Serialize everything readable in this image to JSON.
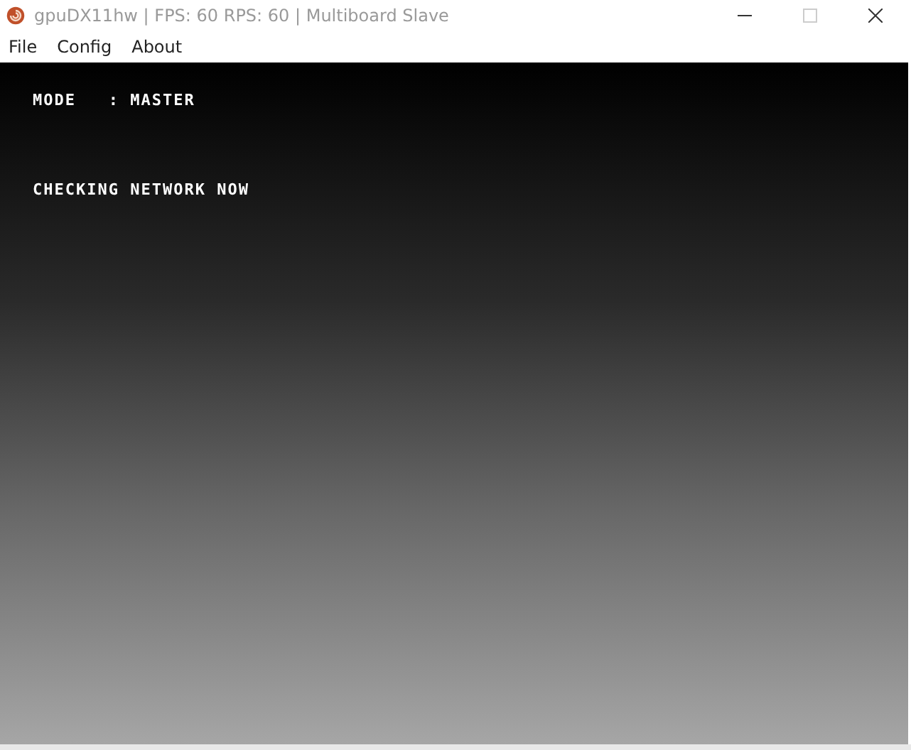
{
  "window": {
    "title": "gpuDX11hw | FPS: 60 RPS: 60 | Multiboard Slave"
  },
  "menu": [
    "File",
    "Config",
    "About"
  ],
  "screen": {
    "lines": [
      {
        "text": "MODE   : MASTER"
      },
      {
        "text": "CHECKING NETWORK NOW"
      }
    ]
  }
}
